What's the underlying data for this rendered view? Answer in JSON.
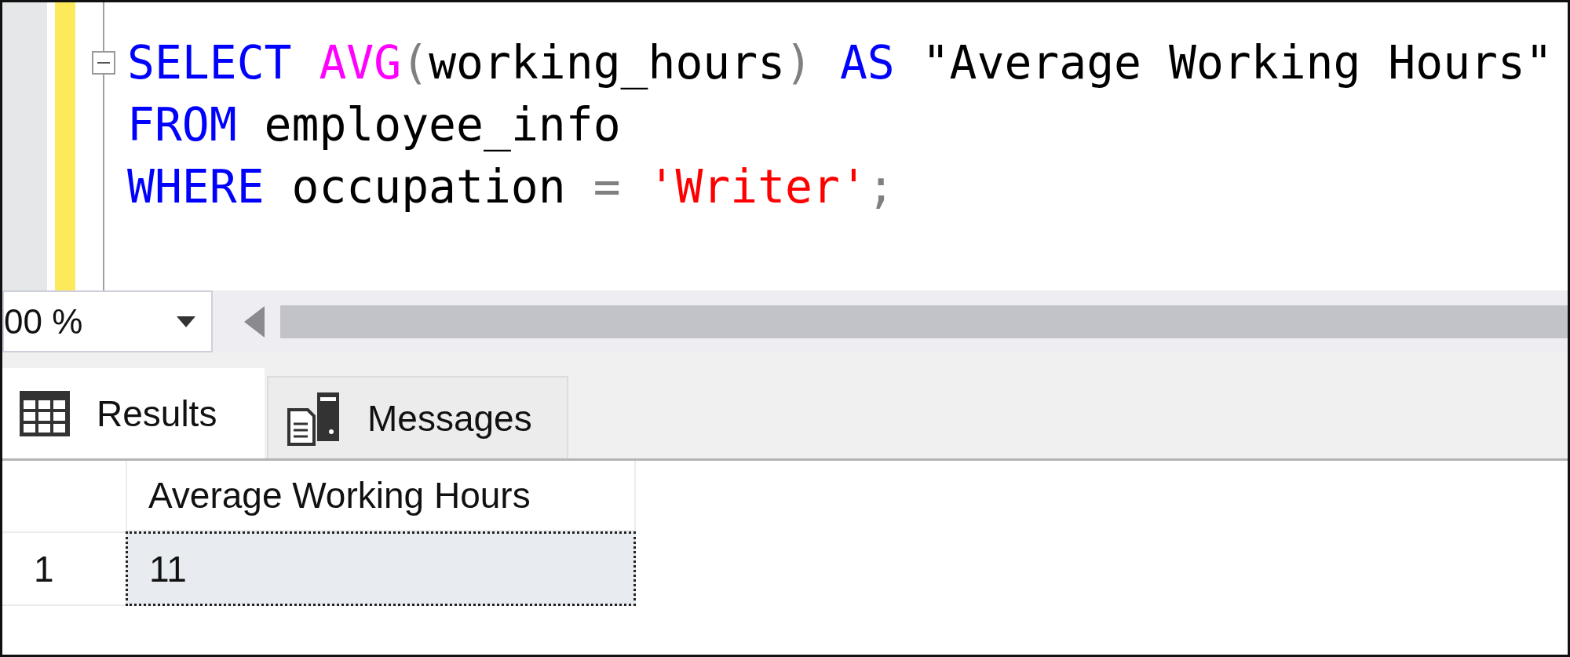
{
  "editor": {
    "lines": [
      {
        "collapsible": true,
        "tokens": [
          {
            "text": "SELECT ",
            "kind": "keyword"
          },
          {
            "text": "AVG",
            "kind": "function"
          },
          {
            "text": "(",
            "kind": "operator"
          },
          {
            "text": "working_hours",
            "kind": "plain"
          },
          {
            "text": ")",
            "kind": "operator"
          },
          {
            "text": " AS ",
            "kind": "keyword"
          },
          {
            "text": "\"Average Working Hours\"",
            "kind": "plain"
          }
        ]
      },
      {
        "collapsible": false,
        "tokens": [
          {
            "text": "FROM ",
            "kind": "keyword"
          },
          {
            "text": "employee_info",
            "kind": "plain"
          }
        ]
      },
      {
        "collapsible": false,
        "tokens": [
          {
            "text": "WHERE ",
            "kind": "keyword"
          },
          {
            "text": "occupation ",
            "kind": "plain"
          },
          {
            "text": "= ",
            "kind": "operator"
          },
          {
            "text": "'Writer'",
            "kind": "string"
          },
          {
            "text": ";",
            "kind": "operator"
          }
        ]
      }
    ]
  },
  "zoom": {
    "value": "00 %"
  },
  "tabs": [
    {
      "label": "Results",
      "kind": "grid",
      "selected": true
    },
    {
      "label": "Messages",
      "kind": "messages",
      "selected": false
    }
  ],
  "grid": {
    "columns": [
      "Average Working Hours"
    ],
    "rows": [
      {
        "number": "1",
        "cells": [
          {
            "value": "11",
            "selected": true
          }
        ]
      }
    ]
  }
}
